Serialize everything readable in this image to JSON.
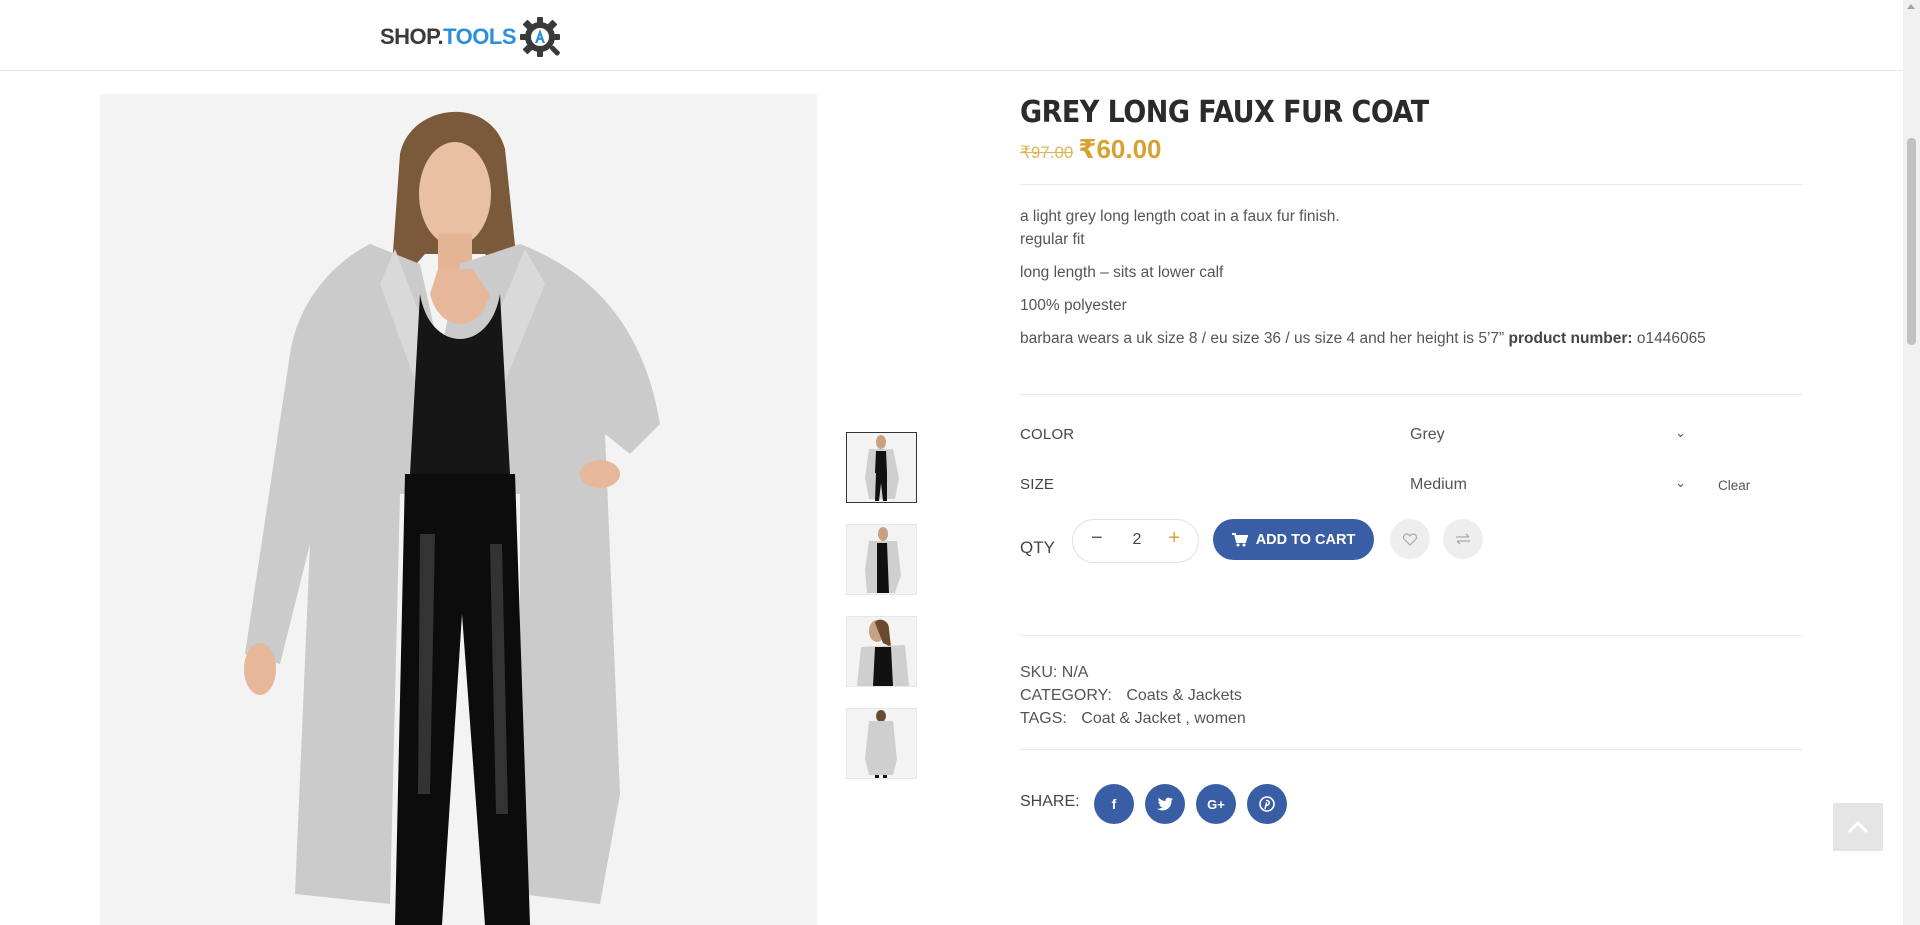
{
  "brand": {
    "logo_part1": "SHOP.",
    "logo_part2": "TOOLS",
    "accent_color": "#2c8fd8"
  },
  "product": {
    "title": "GREY LONG FAUX FUR COAT",
    "old_price": "₹97.00",
    "new_price": "₹60.00",
    "price_color": "#d6a233",
    "description": {
      "line1": "a light grey long length coat in a faux fur finish.",
      "line2": "regular fit",
      "line3": "long length – sits at lower calf",
      "line4": "100% polyester",
      "line5": "barbara wears a uk size 8 / eu size 36 / us size 4 and her height is 5’7”",
      "product_number_label": "product number:",
      "product_number": "o1446065"
    }
  },
  "variations": {
    "color_label": "COLOR",
    "color_value": "Grey",
    "size_label": "SIZE",
    "size_value": "Medium",
    "clear_label": "Clear"
  },
  "purchase": {
    "qty_label": "QTY",
    "qty_value": "2",
    "minus": "−",
    "plus": "+",
    "add_to_cart_label": "ADD TO CART",
    "button_color": "#3a5ea6"
  },
  "meta": {
    "sku_label": "SKU:",
    "sku_value": "N/A",
    "category_label": "CATEGORY:",
    "category_value": "Coats & Jackets",
    "tags_label": "TAGS:",
    "tag1": "Coat & Jacket",
    "tag_sep": " , ",
    "tag2": "women"
  },
  "share": {
    "label": "SHARE:",
    "facebook": "f",
    "googleplus": "G+"
  },
  "icons": {
    "logo": "gear-magnifier-icon",
    "wishlist": "heart-icon",
    "compare": "arrows-icon",
    "cart": "cart-icon",
    "back_to_top": "chevron-up-icon",
    "twitter": "twitter-bird-icon",
    "pinterest": "pinterest-icon"
  }
}
